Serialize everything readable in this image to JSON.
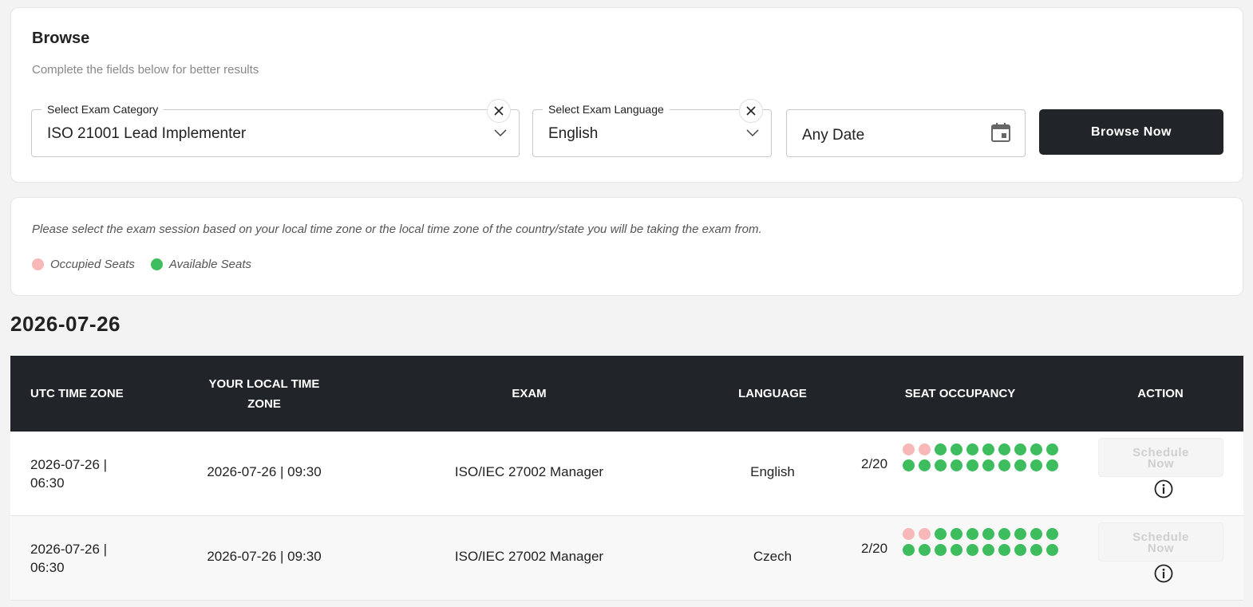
{
  "browse": {
    "title": "Browse",
    "subtitle": "Complete the fields below for better results",
    "category": {
      "label": "Select Exam Category",
      "value": "ISO 21001 Lead Implementer"
    },
    "language": {
      "label": "Select Exam Language",
      "value": "English"
    },
    "date": {
      "value": "Any Date"
    },
    "button_label": "Browse Now"
  },
  "info": {
    "text": "Please select the exam session based on your local time zone or the local time zone of the country/state you will be taking the exam from.",
    "legend": {
      "occupied": "Occupied Seats",
      "available": "Available Seats"
    }
  },
  "date_heading": "2026-07-26",
  "table": {
    "headers": {
      "utc": "UTC TIME ZONE",
      "local_line1": "YOUR LOCAL TIME",
      "local_line2": "ZONE",
      "exam": "EXAM",
      "language": "LANGUAGE",
      "seats": "SEAT OCCUPANCY",
      "action": "ACTION"
    },
    "rows": [
      {
        "utc_line1": "2026-07-26 |",
        "utc_line2": "06:30",
        "local": "2026-07-26 | 09:30",
        "exam": "ISO/IEC 27002 Manager",
        "language": "English",
        "seat_count": "2/20",
        "occupied": 2,
        "total": 20,
        "action_line1": "Schedule",
        "action_line2": "Now"
      },
      {
        "utc_line1": "2026-07-26 |",
        "utc_line2": "06:30",
        "local": "2026-07-26 | 09:30",
        "exam": "ISO/IEC 27002 Manager",
        "language": "Czech",
        "seat_count": "2/20",
        "occupied": 2,
        "total": 20,
        "action_line1": "Schedule",
        "action_line2": "Now"
      }
    ]
  },
  "colors": {
    "header_bg": "#212529",
    "occupied": "#f8b8b8",
    "available": "#3dbd5d"
  },
  "icons": [
    "close-icon",
    "chevron-down-icon",
    "calendar-icon",
    "info-icon"
  ]
}
